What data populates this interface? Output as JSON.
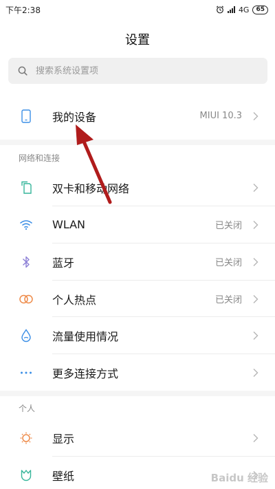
{
  "status_bar": {
    "time": "下午2:38",
    "network": "4G",
    "battery": "65"
  },
  "header": {
    "title": "设置"
  },
  "search": {
    "placeholder": "搜索系统设置项"
  },
  "device": {
    "label": "我的设备",
    "value": "MIUI 10.3"
  },
  "sections": {
    "network": "网络和连接",
    "personal": "个人"
  },
  "network_items": [
    {
      "label": "双卡和移动网络",
      "value": ""
    },
    {
      "label": "WLAN",
      "value": "已关闭"
    },
    {
      "label": "蓝牙",
      "value": "已关闭"
    },
    {
      "label": "个人热点",
      "value": "已关闭"
    },
    {
      "label": "流量使用情况",
      "value": ""
    },
    {
      "label": "更多连接方式",
      "value": ""
    }
  ],
  "personal_items": [
    {
      "label": "显示",
      "value": ""
    },
    {
      "label": "壁纸",
      "value": ""
    }
  ],
  "watermark": "Baidu 经验",
  "colors": {
    "accent_blue": "#3a8ee6",
    "annotation_red": "#b01c1c"
  }
}
